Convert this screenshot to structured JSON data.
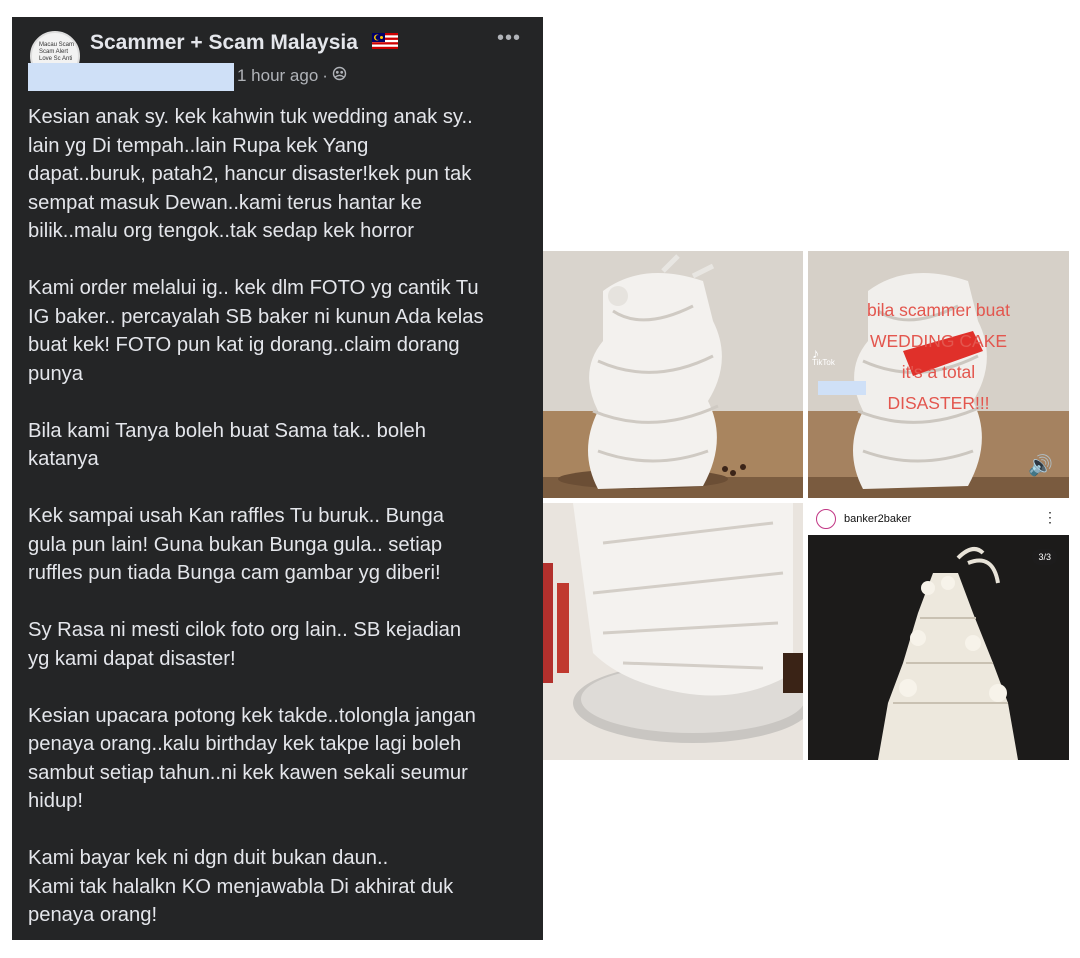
{
  "post": {
    "group_name": "Scammer + Scam Malaysia",
    "avatar_text": "Macau Scam Scam Alert Love Sc Anti",
    "time": "1 hour ago",
    "separator": "·",
    "more_label": "•••",
    "paragraphs": [
      "Kesian anak sy. kek kahwin tuk wedding anak sy..\nlain yg Di tempah..lain Rupa kek Yang\ndapat..buruk, patah2, hancur disaster!kek pun tak\nsempat masuk Dewan..kami terus hantar ke\nbilik..malu org tengok..tak sedap kek horror",
      "Kami order melalui ig.. kek dlm FOTO yg cantik Tu\nIG baker.. percayalah SB baker ni kunun Ada kelas\nbuat kek! FOTO pun kat ig dorang..claim dorang\npunya",
      "Bila kami Tanya boleh buat Sama tak.. boleh\nkatanya",
      "Kek sampai usah Kan raffles Tu buruk.. Bunga\ngula pun lain! Guna bukan Bunga gula.. setiap\nruffles pun tiada Bunga cam gambar yg diberi!",
      "Sy Rasa ni mesti cilok foto org lain.. SB kejadian\nyg kami dapat disaster!",
      "Kesian upacara potong kek takde..tolongla jangan\npenaya orang..kalu birthday kek takpe lagi boleh\nsambut setiap tahun..ni kek kawen sekali seumur\nhidup!",
      "Kami bayar kek ni dgn duit bukan daun..\nKami tak halalkn KO menjawabla Di akhirat duk\npenaya orang!"
    ]
  },
  "photos": {
    "tiktok_overlay": [
      "bila scammer buat",
      "WEDDING CAKE",
      "it's a total",
      "DISASTER!!!"
    ],
    "tiktok_label": "TikTok",
    "ig_username": "banker2baker",
    "ig_more": "⋮",
    "ig_page_badge": "3/3"
  },
  "colors": {
    "post_bg": "#242526",
    "text": "#e4e6eb",
    "secondary": "#b0b3b8",
    "overlay_red": "#e3564e"
  }
}
